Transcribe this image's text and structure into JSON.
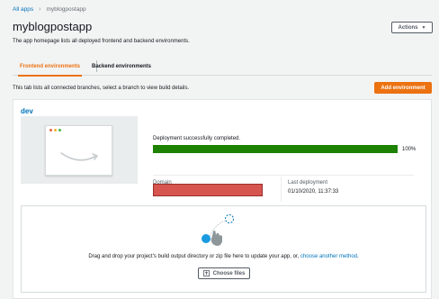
{
  "breadcrumb": {
    "root": "All apps",
    "current": "myblogpostapp"
  },
  "header": {
    "title": "myblogpostapp",
    "description": "The app homepage lists all deployed frontend and backend environments.",
    "actions_label": "Actions"
  },
  "tabs": [
    {
      "label": "Frontend environments",
      "active": true
    },
    {
      "label": "Backend environments",
      "active": false
    }
  ],
  "tab_description": "This tab lists all connected branches, select a branch to view build details.",
  "add_environment_label": "Add environment",
  "branch": {
    "name": "dev",
    "status_text": "Deployment successfully completed.",
    "progress_percent": 100,
    "progress_label": "100%",
    "domain_label": "Domain",
    "last_deployment_label": "Last deployment",
    "last_deployment_value": "01/10/2020, 11:37:33"
  },
  "dropzone": {
    "text_main": "Drag and drop your project's build output directory or zip file here to update your app, or, ",
    "text_link": "choose another method",
    "text_end": ".",
    "button_label": "Choose files"
  },
  "colors": {
    "accent": "#ec7211",
    "link": "#0073bb",
    "success": "#1d8102",
    "redaction": "#d6554f"
  },
  "icons": [
    "chevron-right-icon",
    "caret-down-icon",
    "amazon-smile-icon",
    "drag-drop-illustration-icon",
    "upload-icon"
  ]
}
